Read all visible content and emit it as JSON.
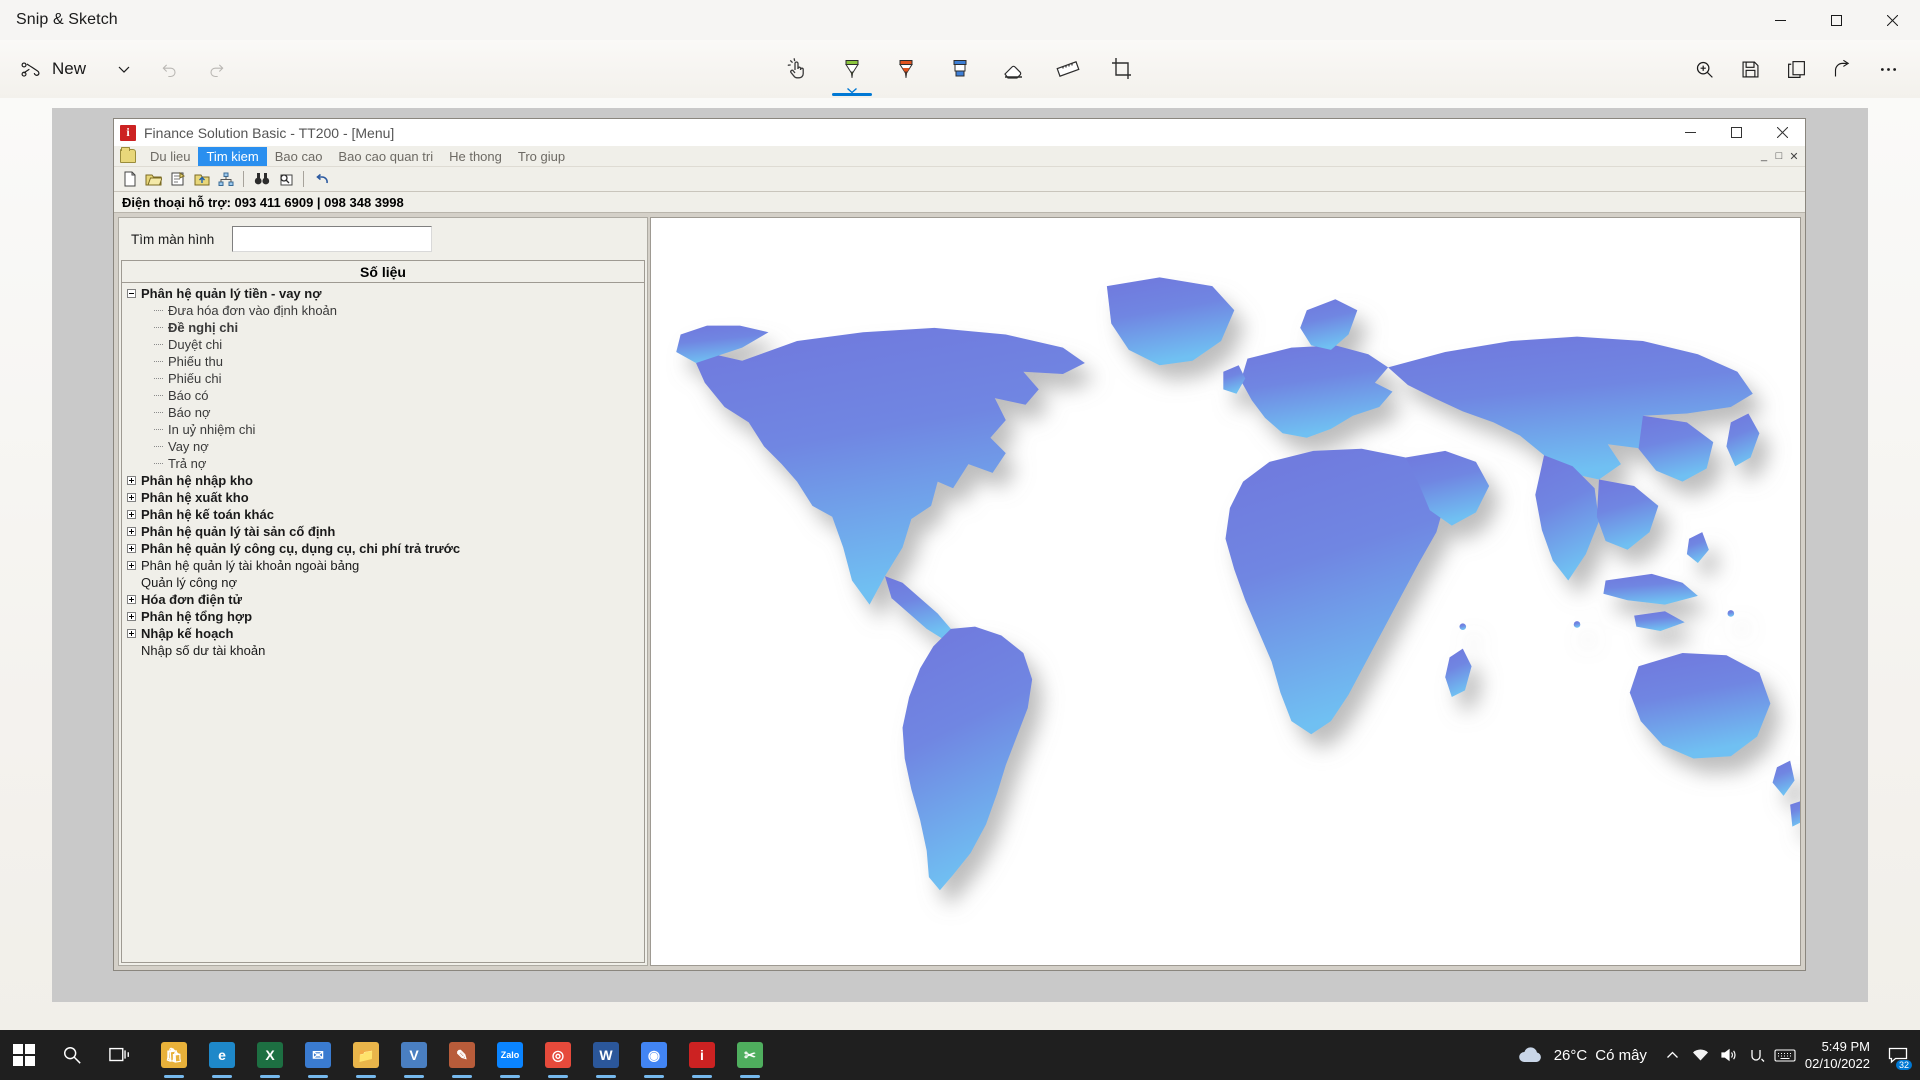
{
  "snip": {
    "title": "Snip & Sketch",
    "caption": {
      "minimize": "minimize-icon",
      "maximize": "maximize-icon",
      "close": "close-icon"
    },
    "toolbar": {
      "new_label": "New",
      "new_dropdown": "chevron-down-icon",
      "undo": "undo-icon",
      "redo": "redo-icon",
      "tools": [
        {
          "name": "touch-writing",
          "label": "Touch writing",
          "active": false
        },
        {
          "name": "ballpoint-pen",
          "label": "Ballpoint pen",
          "active": true,
          "color": "#8cc63e"
        },
        {
          "name": "pencil",
          "label": "Pencil",
          "active": false,
          "color": "#e0531f"
        },
        {
          "name": "highlighter",
          "label": "Highlighter",
          "active": false,
          "color": "#3d7fd6"
        },
        {
          "name": "eraser",
          "label": "Eraser",
          "active": false
        },
        {
          "name": "ruler",
          "label": "Ruler",
          "active": false
        },
        {
          "name": "crop",
          "label": "Image crop",
          "active": false
        }
      ],
      "right_tools": [
        {
          "name": "zoom",
          "label": "Zoom"
        },
        {
          "name": "save-as",
          "label": "Save as"
        },
        {
          "name": "copy",
          "label": "Copy"
        },
        {
          "name": "share",
          "label": "Share"
        },
        {
          "name": "see-more",
          "label": "See more"
        }
      ]
    }
  },
  "app": {
    "title": "Finance Solution Basic - TT200 - [Menu]",
    "icon": "i",
    "caption": {
      "minimize": "minimize-icon",
      "restore": "restore-icon",
      "close": "close-icon"
    },
    "menu": {
      "folder_icon": "folder-icon",
      "items": [
        {
          "label": "Du lieu",
          "selected": false
        },
        {
          "label": "Tim kiem",
          "selected": true
        },
        {
          "label": "Bao cao",
          "selected": false
        },
        {
          "label": "Bao cao quan tri",
          "selected": false
        },
        {
          "label": "He thong",
          "selected": false
        },
        {
          "label": "Tro giup",
          "selected": false
        }
      ],
      "mdi": [
        "_",
        "□",
        "✕"
      ]
    },
    "toolbar_icons": [
      "new-document-icon",
      "open-folder-icon",
      "properties-icon",
      "move-up-folder-icon",
      "org-chart-icon",
      "find-binoculars-icon",
      "find-replace-icon",
      "undo-arrow-icon"
    ],
    "support_text": "Điện thoại hỗ trợ: 093 411 6909 | 098 348 3998",
    "search": {
      "label": "Tìm màn hình",
      "value": "",
      "placeholder": ""
    },
    "tree_header": "Số liệu",
    "tree": [
      {
        "label": "Phân hệ quản lý tiền -  vay nợ",
        "level": 0,
        "bold": true,
        "state": "expanded"
      },
      {
        "label": "Đưa hóa đơn vào định khoản",
        "level": 1,
        "bold": false,
        "state": "leaf"
      },
      {
        "label": "Đề nghị chi",
        "level": 1,
        "bold": true,
        "state": "leaf"
      },
      {
        "label": "Duyệt chi",
        "level": 1,
        "bold": false,
        "state": "leaf"
      },
      {
        "label": "Phiếu thu",
        "level": 1,
        "bold": false,
        "state": "leaf"
      },
      {
        "label": "Phiếu chi",
        "level": 1,
        "bold": false,
        "state": "leaf"
      },
      {
        "label": "Báo có",
        "level": 1,
        "bold": false,
        "state": "leaf"
      },
      {
        "label": "Báo nợ",
        "level": 1,
        "bold": false,
        "state": "leaf"
      },
      {
        "label": "In uỷ nhiệm chi",
        "level": 1,
        "bold": false,
        "state": "leaf"
      },
      {
        "label": "Vay nợ",
        "level": 1,
        "bold": false,
        "state": "leaf"
      },
      {
        "label": "Trả nợ",
        "level": 1,
        "bold": false,
        "state": "leaf"
      },
      {
        "label": "Phân hệ nhập kho",
        "level": 0,
        "bold": true,
        "state": "collapsed"
      },
      {
        "label": "Phân hệ xuất kho",
        "level": 0,
        "bold": true,
        "state": "collapsed"
      },
      {
        "label": "Phân hệ kế toán khác",
        "level": 0,
        "bold": true,
        "state": "collapsed"
      },
      {
        "label": "Phân hệ quản lý tài sản cố định",
        "level": 0,
        "bold": true,
        "state": "collapsed"
      },
      {
        "label": "Phân hệ quản lý công cụ, dụng cụ, chi phí trả trước",
        "level": 0,
        "bold": true,
        "state": "collapsed"
      },
      {
        "label": "Phân hệ quản lý tài khoản ngoài bảng",
        "level": 0,
        "bold": false,
        "state": "collapsed"
      },
      {
        "label": "Quản lý công nợ",
        "level": 0,
        "bold": false,
        "state": "none"
      },
      {
        "label": "Hóa đơn điện tử",
        "level": 0,
        "bold": true,
        "state": "collapsed"
      },
      {
        "label": "Phân hệ  tổng hợp",
        "level": 0,
        "bold": true,
        "state": "collapsed"
      },
      {
        "label": "Nhập kế hoạch",
        "level": 0,
        "bold": true,
        "state": "collapsed"
      },
      {
        "label": "Nhập số dư tài khoản",
        "level": 0,
        "bold": false,
        "state": "none"
      }
    ],
    "preview_image": "world-map"
  },
  "taskbar": {
    "start": "windows-start-icon",
    "search": "search-icon",
    "task_view": "task-view-icon",
    "apps": [
      {
        "name": "microsoft-store",
        "glyph": "🛍",
        "color": "#e8b13a",
        "running": true
      },
      {
        "name": "microsoft-edge",
        "glyph": "e",
        "color": "#1e88c9",
        "running": true
      },
      {
        "name": "microsoft-excel",
        "glyph": "X",
        "color": "#1d6f42",
        "running": true
      },
      {
        "name": "teams-or-outlook",
        "glyph": "✉",
        "color": "#3a7bd0",
        "running": true
      },
      {
        "name": "file-explorer",
        "glyph": "📁",
        "color": "#e9b54a",
        "running": true
      },
      {
        "name": "unikey",
        "glyph": "V",
        "color": "#4a7fc1",
        "running": true
      },
      {
        "name": "visual-tool",
        "glyph": "✎",
        "color": "#b85c3a",
        "running": true
      },
      {
        "name": "zalo",
        "glyph": "Zalo",
        "color": "#0a84ff",
        "running": true
      },
      {
        "name": "chrome-canary",
        "glyph": "◎",
        "color": "#e64a3b",
        "running": true
      },
      {
        "name": "microsoft-word",
        "glyph": "W",
        "color": "#2b579a",
        "running": true
      },
      {
        "name": "google-chrome",
        "glyph": "◉",
        "color": "#4285f4",
        "running": true
      },
      {
        "name": "finance-solution-basic",
        "glyph": "i",
        "color": "#cc2222",
        "running": true
      },
      {
        "name": "snip-and-sketch",
        "glyph": "✂",
        "color": "#4fae5e",
        "running": true
      }
    ],
    "weather": {
      "temperature": "26°C",
      "description": "Có mây",
      "icon": "cloud-icon"
    },
    "tray": [
      {
        "name": "show-hidden-icons",
        "glyph": "^"
      },
      {
        "name": "network-icon",
        "glyph": "🖧"
      },
      {
        "name": "volume-icon",
        "glyph": "🔊"
      },
      {
        "name": "unikey-tray-icon",
        "glyph": "U"
      },
      {
        "name": "keyboard-layout-icon",
        "glyph": "⌨"
      }
    ],
    "clock": {
      "time": "5:49 PM",
      "date": "02/10/2022"
    },
    "notifications": {
      "icon": "notification-icon",
      "count": "32"
    }
  }
}
